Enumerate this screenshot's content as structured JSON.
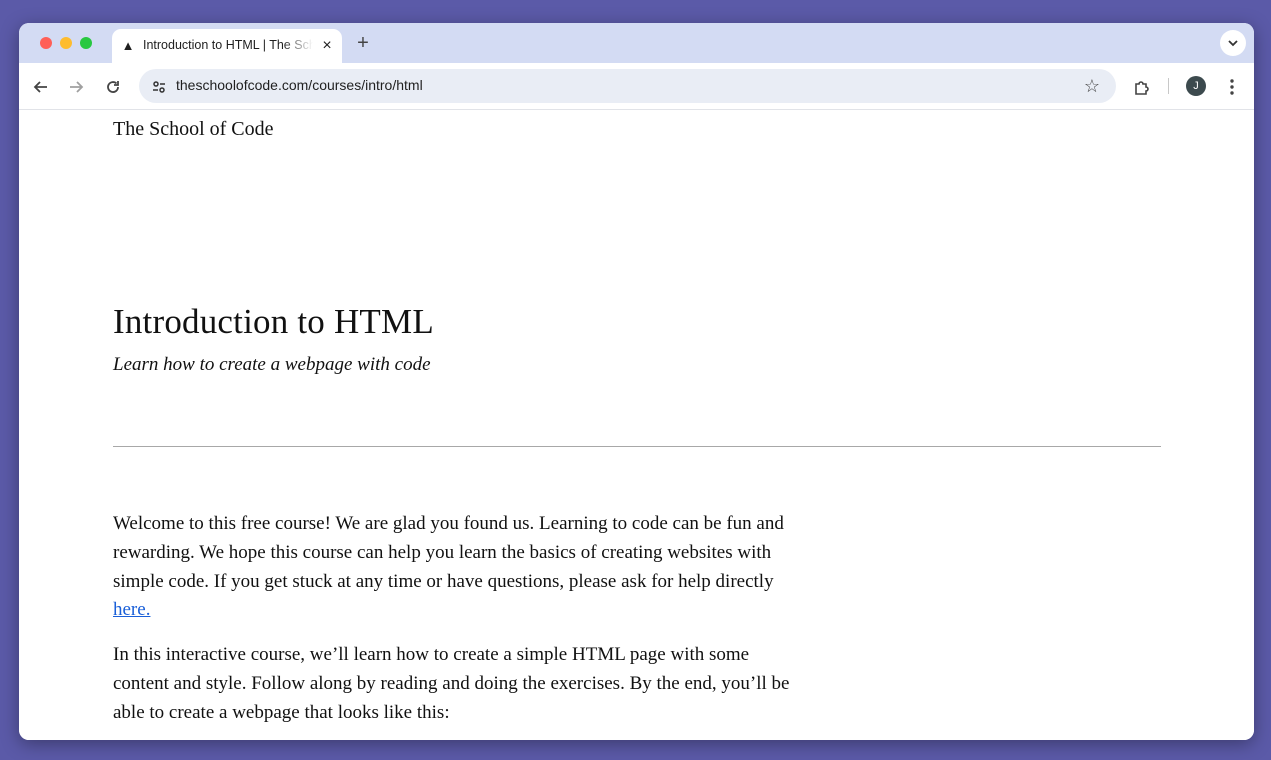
{
  "browser": {
    "tab": {
      "title": "Introduction to HTML | The School of Code",
      "favicon": "rocket-icon"
    },
    "new_tab_label": "+",
    "close_tab_label": "×",
    "url": "theschoolofcode.com/courses/intro/html",
    "profile_initial": "J",
    "colors": {
      "tabstrip": "#d3dbf3",
      "omnibox": "#e9edf5",
      "desktop": "#5b5aa8"
    }
  },
  "page": {
    "site_name": "The School of Code",
    "title": "Introduction to HTML",
    "subtitle": "Learn how to create a webpage with code",
    "paragraphs": [
      {
        "text": "Welcome to this free course! We are glad you found us. Learning to code can be fun and rewarding. We hope this course can help you learn the basics of creating websites with simple code. If you get stuck at any time or have questions, please ask for help directly ",
        "link": "here."
      },
      {
        "text": "In this interactive course, we’ll learn how to create a simple HTML page with some content and style. Follow along by reading and doing the exercises. By the end, you’ll be able to create a webpage that looks like this:"
      }
    ],
    "link_color": "#1a5fd8"
  }
}
